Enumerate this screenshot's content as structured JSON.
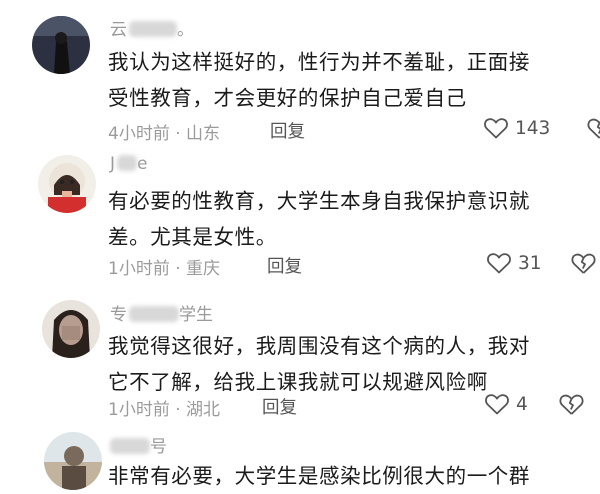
{
  "comments": [
    {
      "username_visible": "云",
      "username_suffix": "。",
      "text_line1": "我认为这样挺好的，性行为并不羞耻，正面接",
      "text_line2": "受性教育，才会更好的保护自己爱自己",
      "time": "4小时前",
      "location": "山东",
      "reply_label": "回复",
      "like_count": "143"
    },
    {
      "username_visible": "J",
      "username_suffix": "e",
      "text_line1": "有必要的性教育，大学生本身自我保护意识就",
      "text_line2": "差。尤其是女性。",
      "time": "1小时前",
      "location": "重庆",
      "reply_label": "回复",
      "like_count": "31"
    },
    {
      "username_visible": "专",
      "username_suffix": "学生",
      "text_line1": "我觉得这很好，我周围没有这个病的人，我对",
      "text_line2": "它不了解，给我上课我就可以规避风险啊",
      "time": "1小时前",
      "location": "湖北",
      "reply_label": "回复",
      "like_count": "4"
    },
    {
      "username_visible": "",
      "username_suffix": "号",
      "text_line1": "非常有必要，大学生是感染比例很大的一个群",
      "time": "",
      "location": ""
    }
  ],
  "icons": {
    "like": "heart-outline-icon",
    "dislike": "broken-heart-icon"
  },
  "colors": {
    "meta_gray": "#9b9b9b",
    "text": "#1b1b1b",
    "icon_gray": "#555555"
  }
}
